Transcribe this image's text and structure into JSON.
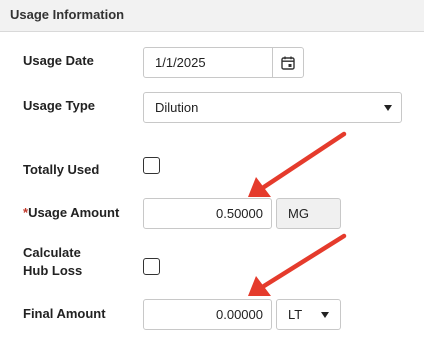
{
  "panel": {
    "title": "Usage Information"
  },
  "fields": {
    "usage_date": {
      "label": "Usage Date",
      "value": "1/1/2025"
    },
    "usage_type": {
      "label": "Usage Type",
      "value": "Dilution"
    },
    "totally_used": {
      "label": "Totally Used",
      "checked": false
    },
    "usage_amount": {
      "required_mark": "*",
      "label": "Usage Amount",
      "value": "0.50000",
      "unit": "MG"
    },
    "calculate_hub_loss": {
      "label_line1": "Calculate",
      "label_line2": "Hub Loss",
      "checked": false
    },
    "final_amount": {
      "label": "Final Amount",
      "value": "0.00000",
      "unit": "LT"
    }
  },
  "annotations": {
    "arrow_color": "#e53b2c"
  },
  "icons": {
    "calendar": "calendar-icon",
    "dropdown": "chevron-down-icon"
  }
}
